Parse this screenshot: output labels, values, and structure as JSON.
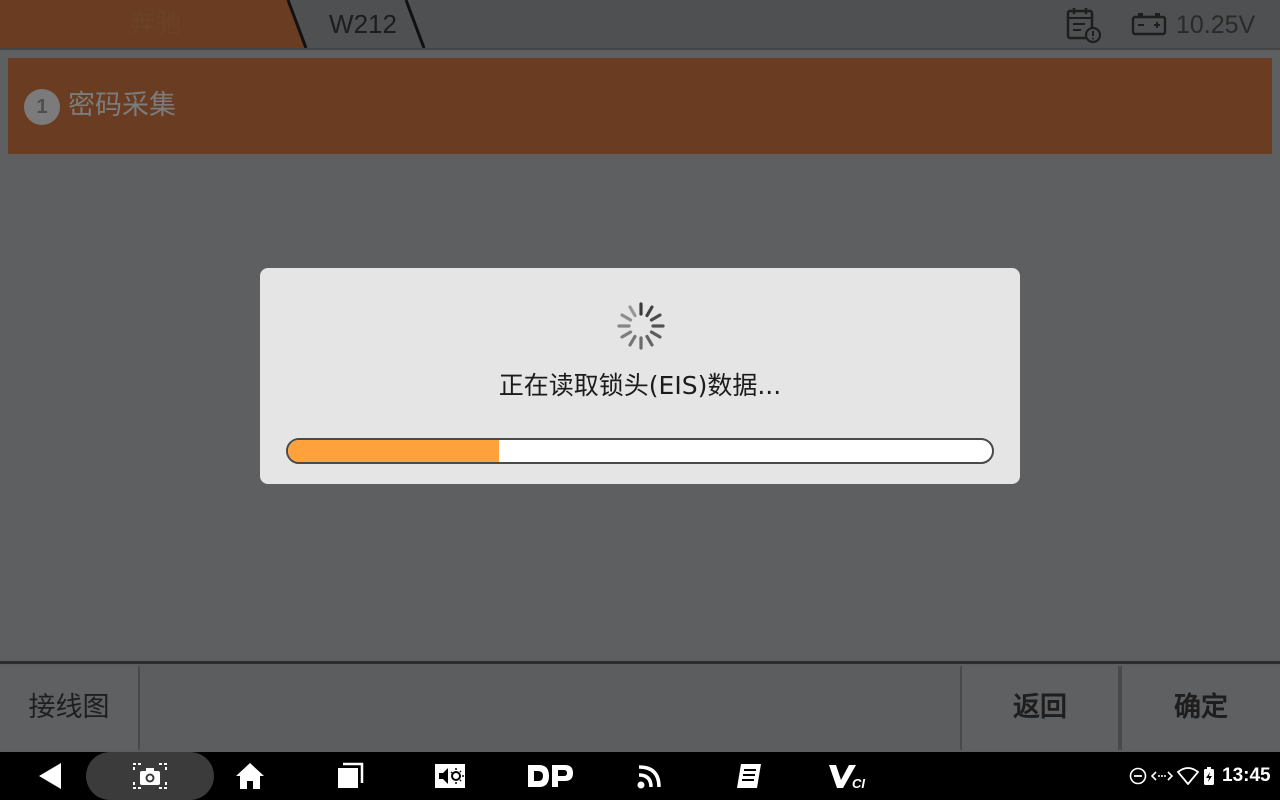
{
  "topbar": {
    "breadcrumb": [
      "奔驰",
      "W212"
    ],
    "voltage": "10.25V",
    "icons": {
      "calendar": "calendar-alert-icon",
      "battery": "battery-icon"
    }
  },
  "step": {
    "number": "1",
    "title": "密码采集"
  },
  "dialog": {
    "message": "正在读取锁头(EIS)数据...",
    "progress": 0.3
  },
  "buttons": {
    "wiring": "接线图",
    "back": "返回",
    "confirm": "确定"
  },
  "navbar": {
    "icons": [
      "back-icon",
      "screenshot-icon",
      "home-icon",
      "recents-icon",
      "volume-brightness-icon",
      "dp-icon",
      "wireless-icon",
      "manual-icon",
      "vci-icon"
    ],
    "status_icons": [
      "dnd-icon",
      "data-transfer-icon",
      "wifi-icon",
      "battery-charging-icon"
    ],
    "clock": "13:45"
  },
  "colors": {
    "accent": "#6a3d22",
    "progress": "#ffa23b",
    "dialog_bg": "#e5e5e5"
  }
}
